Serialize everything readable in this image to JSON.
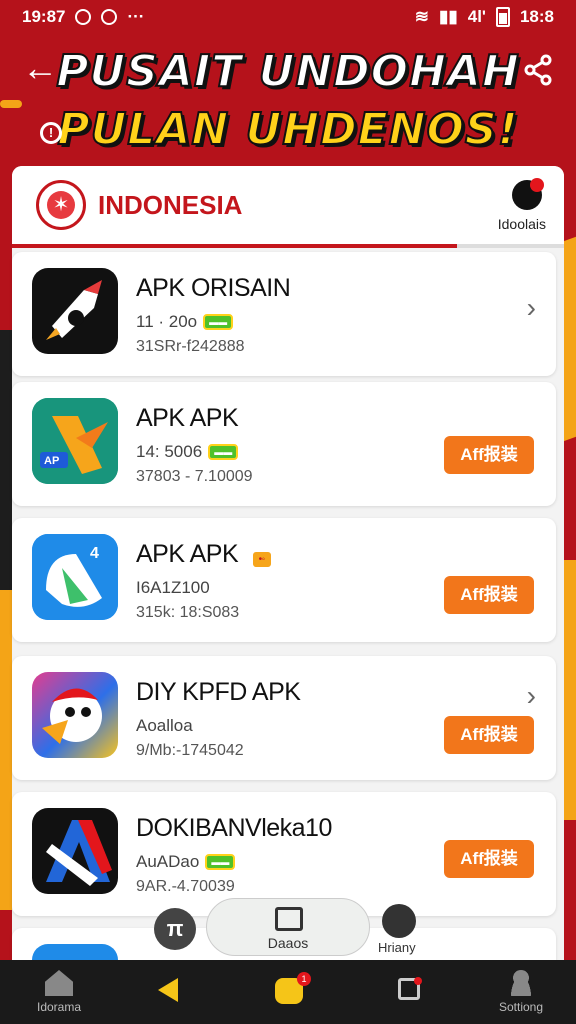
{
  "status_bar": {
    "time": "19:87",
    "network": "4l'",
    "battery": "18:8"
  },
  "header": {
    "title_line1": "PUSAIT UNDOHAH",
    "title_line2": "PULAN UHDENOS!",
    "info_glyph": "!"
  },
  "section": {
    "country": "INDONESIA",
    "brand_label": "Idoolais"
  },
  "apps": [
    {
      "name": "APK ORISAIN",
      "meta": "11 · 20o",
      "sub": "31SRr-f242888",
      "badge": "green",
      "action": "chevron"
    },
    {
      "name": "APK APK",
      "meta": "14: 5006",
      "sub": "37803 - 7.10009",
      "badge": "green",
      "action": "install"
    },
    {
      "name": "APK APK",
      "meta": "I6A1Z100",
      "sub": "315k: 18:S083",
      "badge": "orange",
      "action": "install"
    },
    {
      "name": "DIY KPFD APK",
      "meta": "Aoalloa",
      "sub": "9/Mb:-1745042",
      "badge": "",
      "action": "both"
    },
    {
      "name": "DOKIBANVleka10",
      "meta": "AuADao",
      "sub": "9AR.-4.70039",
      "badge": "green",
      "action": "install"
    }
  ],
  "install_label": "Aff报装",
  "float_nav": {
    "left_glyph": "π",
    "center_label": "Daaos",
    "right_label": "Hriany"
  },
  "bottom_nav": {
    "home_label": "Idorama",
    "settings_label": "Sottiong",
    "notif_count": "1"
  },
  "colors": {
    "primary_red": "#c4161c",
    "accent_orange": "#f2761b",
    "title_yellow": "#ffd21a"
  }
}
